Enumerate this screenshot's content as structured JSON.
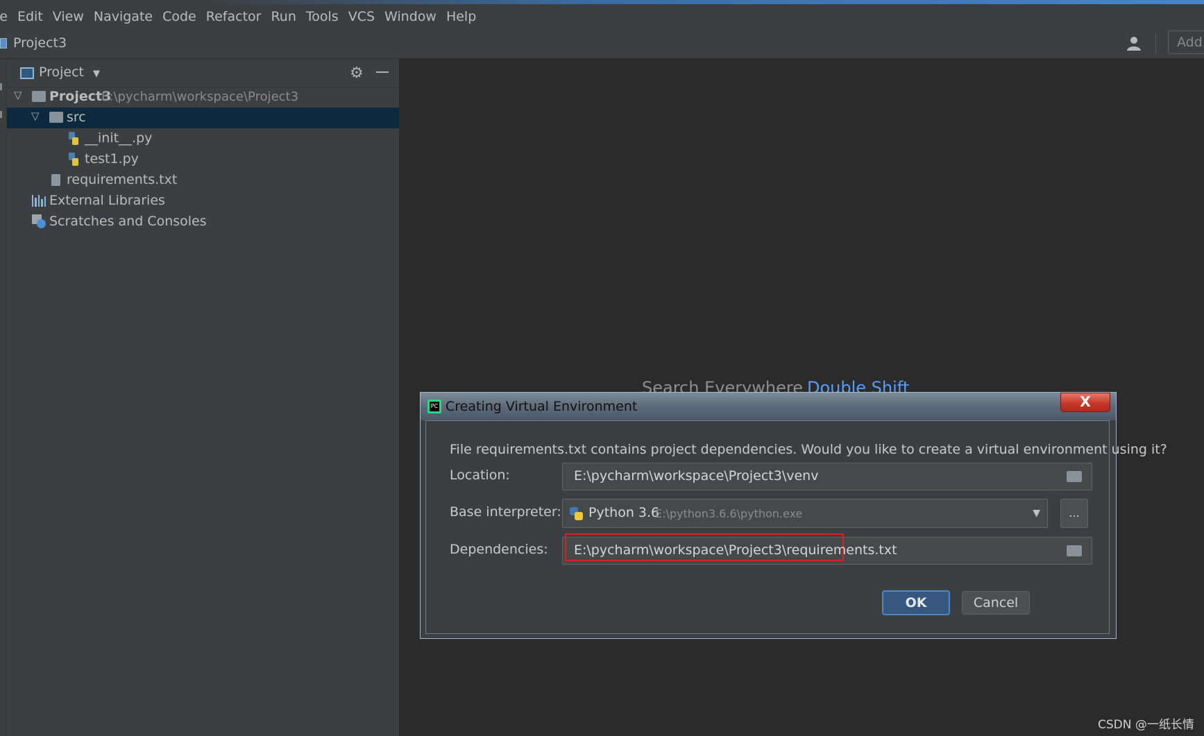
{
  "menu": [
    "le",
    "Edit",
    "View",
    "Navigate",
    "Code",
    "Refactor",
    "Run",
    "Tools",
    "VCS",
    "Window",
    "Help"
  ],
  "navbar": {
    "project_name": "Project3",
    "add_label": "Add"
  },
  "project_panel": {
    "title": "Project",
    "tree": {
      "root_name": "Project3",
      "root_path": "E:\\pycharm\\workspace\\Project3",
      "src": "src",
      "init_file": "__init__.py",
      "test_file": "test1.py",
      "requirements": "requirements.txt",
      "external_libraries": "External Libraries",
      "scratches": "Scratches and Consoles"
    }
  },
  "editor": {
    "hint_text": "Search Everywhere",
    "hint_shortcut": "Double Shift"
  },
  "dialog": {
    "title": "Creating Virtual Environment",
    "close_label": "X",
    "message": "File requirements.txt contains project dependencies. Would you like to create a virtual environment using it?",
    "location_label": "Location:",
    "location_value": "E:\\pycharm\\workspace\\Project3\\venv",
    "interpreter_label": "Base interpreter:",
    "interpreter_name": "Python 3.6",
    "interpreter_path": "E:\\python3.6.6\\python.exe",
    "browse_label": "...",
    "dependencies_label": "Dependencies:",
    "dependencies_value": "E:\\pycharm\\workspace\\Project3\\requirements.txt",
    "ok_label": "OK",
    "cancel_label": "Cancel"
  },
  "watermark": "CSDN @一纸长情",
  "colors": {
    "highlight": "#e02020",
    "link": "#589df6",
    "selection": "#0d293e"
  }
}
